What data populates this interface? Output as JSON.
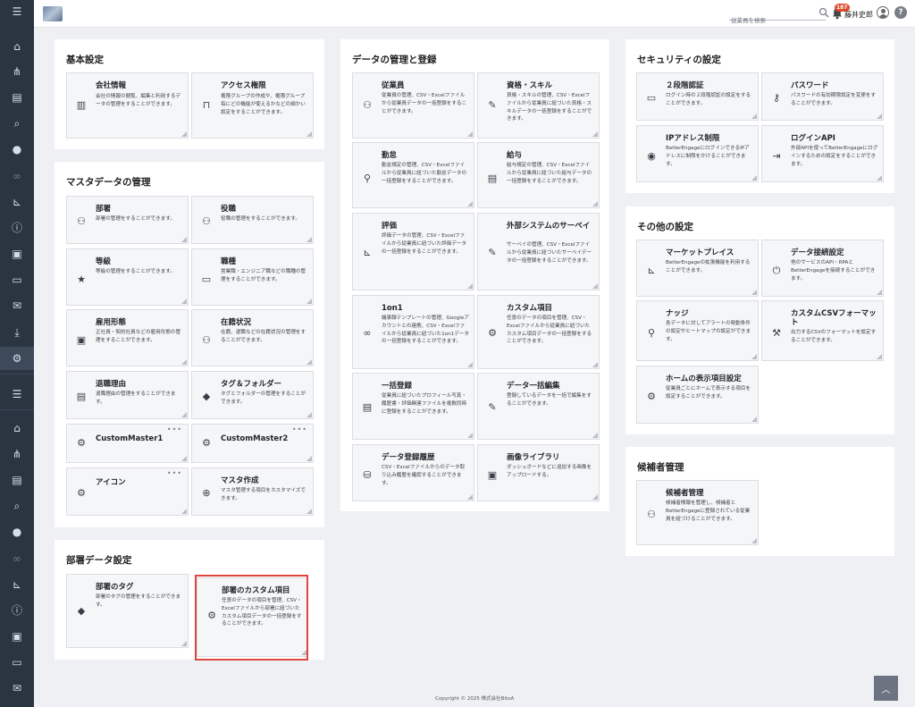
{
  "header": {
    "search_placeholder": "従業員を検索",
    "notification_count": "187",
    "user_name": "藤井史郎",
    "help_label": "?"
  },
  "sidebar": {
    "icons": [
      "menu-icon",
      "home-icon",
      "org-chart-icon",
      "document-icon",
      "search-icon",
      "chat-icon",
      "link-icon",
      "chart-icon",
      "info-icon",
      "badge-icon",
      "book-icon",
      "mail-icon",
      "download-icon",
      "user-settings-icon",
      "menu-icon",
      "home-icon",
      "org-chart-icon",
      "document-icon",
      "search-icon",
      "chat-icon",
      "link-icon",
      "chart-icon",
      "info-icon",
      "badge-icon",
      "book-icon",
      "mail-icon"
    ]
  },
  "sections": {
    "basic": {
      "title": "基本設定",
      "cards": [
        {
          "title": "会社情報",
          "desc": "会社の情報の閲覧、編集と利用するデータの管理をすることができます。",
          "icon": "building-icon"
        },
        {
          "title": "アクセス権限",
          "desc": "権限グループの作成や、権限グループ毎にどの機能が使えるかなどの細かい設定をすることができます。",
          "icon": "lock-icon"
        }
      ]
    },
    "master": {
      "title": "マスタデータの管理",
      "cards": [
        {
          "title": "部署",
          "desc": "部署の管理をすることができます。",
          "icon": "department-icon"
        },
        {
          "title": "役職",
          "desc": "役職の管理をすることができます。",
          "icon": "position-icon"
        },
        {
          "title": "等級",
          "desc": "等級の管理をすることができます。",
          "icon": "star-icon"
        },
        {
          "title": "職種",
          "desc": "営業職・エンジニア職などの職種の管理をすることができます。",
          "icon": "briefcase-icon"
        },
        {
          "title": "雇用形態",
          "desc": "正社員・契約社員などの雇用形態の管理をすることができます。",
          "icon": "id-card-icon"
        },
        {
          "title": "在籍状況",
          "desc": "在籍、退職などの在籍状況の管理をすることができます。",
          "icon": "status-icon"
        },
        {
          "title": "退職理由",
          "desc": "退職理由の管理をすることができます。",
          "icon": "exit-icon"
        },
        {
          "title": "タグ＆フォルダー",
          "desc": "タグとフォルダーの管理をすることができます。",
          "icon": "tag-icon"
        },
        {
          "title": "CustomMaster1",
          "desc": "",
          "icon": "gears-icon",
          "dots": "•••"
        },
        {
          "title": "CustomMaster2",
          "desc": "",
          "icon": "gears-icon",
          "dots": "•••"
        },
        {
          "title": "アイコン",
          "desc": "",
          "icon": "gears-icon",
          "dots": "•••"
        },
        {
          "title": "マスタ作成",
          "desc": "マスタ管理する項目をカスタマイズできます。",
          "icon": "plus-circle-icon"
        }
      ]
    },
    "dept": {
      "title": "部署データ設定",
      "cards": [
        {
          "title": "部署のタグ",
          "desc": "部署のタグの管理をすることができます。",
          "icon": "tag-icon"
        },
        {
          "title": "部署のカスタム項目",
          "desc": "任意のデータの項目を管理、CSV・Excelファイルから部署に紐づいたカスタム項目データの一括登録をすることができます。",
          "icon": "gear-icon"
        }
      ]
    },
    "data": {
      "title": "データの管理と登録",
      "cards": [
        {
          "title": "従業員",
          "desc": "従業員の管理、CSV・Excelファイルから従業員データの一括登録をすることができます。",
          "icon": "users-icon"
        },
        {
          "title": "資格・スキル",
          "desc": "資格・スキルの管理、CSV・Excelファイルから従業員に紐づいた資格・スキルデータの一括登録をすることができます。",
          "icon": "skill-icon"
        },
        {
          "title": "勤怠",
          "desc": "勤怠規定の管理、CSV・Excelファイルから従業員に紐づいた勤怠データの一括登録をすることができます。",
          "icon": "attendance-icon"
        },
        {
          "title": "給与",
          "desc": "給与規定の管理、CSV・Excelファイルから従業員に紐づいた給与データの一括登録をすることができます。",
          "icon": "salary-icon"
        },
        {
          "title": "評価",
          "desc": "評価データの管理、CSV・Excelファイルから従業員に紐づいた評価データの一括登録をすることができます。",
          "icon": "evaluation-icon"
        },
        {
          "title": "外部システムのサーベイ",
          "desc": "サーベイの管理、CSV・Excelファイルから従業員に紐づいたサーベイデータの一括登録をすることができます。",
          "icon": "survey-icon"
        },
        {
          "title": "1on1",
          "desc": "議事録テンプレートの管理、Googleアカウントとの連携、CSV・Excelファイルから従業員に紐づいた1on1データの一括登録をすることができます。",
          "icon": "meeting-icon"
        },
        {
          "title": "カスタム項目",
          "desc": "任意のデータの項目を管理、CSV・Excelファイルから従業員に紐づいたカスタム項目データの一括登録をすることができます。",
          "icon": "gear-icon"
        },
        {
          "title": "一括登録",
          "desc": "従業員に紐づいたプロフィール写真・履歴書・評価関連ファイルを複数同時に登録をすることができます。",
          "icon": "bulk-upload-icon"
        },
        {
          "title": "データ一括編集",
          "desc": "登録しているデータを一括で編集をすることができます。",
          "icon": "pencil-icon"
        },
        {
          "title": "データ登録履歴",
          "desc": "CSV・Excelファイルからのデータ取り込み履歴を確認することができます。",
          "icon": "database-icon"
        },
        {
          "title": "画像ライブラリ",
          "desc": "ダッシュボードなどに追加する画像をアップロードする。",
          "icon": "image-icon"
        }
      ]
    },
    "security": {
      "title": "セキュリティの設定",
      "cards": [
        {
          "title": "２段階認証",
          "desc": "ログイン時の２段階認証の設定をすることができます。",
          "icon": "two-factor-icon"
        },
        {
          "title": "パスワード",
          "desc": "パスワードの有効期限設定を変更をすることができます。",
          "icon": "key-icon"
        },
        {
          "title": "IPアドレス制限",
          "desc": "BetterEngageにログインできるIPアドレスに制限をかけることができます。",
          "icon": "location-icon"
        },
        {
          "title": "ログインAPI",
          "desc": "外部APIを使ってBetterEngageにログインするための設定をすることができます。",
          "icon": "login-icon"
        }
      ]
    },
    "other": {
      "title": "その他の設定",
      "cards": [
        {
          "title": "マーケットプレイス",
          "desc": "BetterEngageの拡張機能を利用することができます。",
          "icon": "chart-line-icon"
        },
        {
          "title": "データ接続設定",
          "desc": "他のサービスのAPI・RPAとBetterEngageを接続することができます。",
          "icon": "plug-icon"
        },
        {
          "title": "ナッジ",
          "desc": "各データに対してアラートの発動条件の設定やヒートマップの設定ができます。",
          "icon": "nudge-icon"
        },
        {
          "title": "カスタムCSVフォーマット",
          "desc": "出力するCSVのフォーマットを設定することができます。",
          "icon": "csv-format-icon"
        },
        {
          "title": "ホームの表示項目設定",
          "desc": "従業員ごとにホームで表示する項目を設定することができます。",
          "icon": "home-settings-icon"
        }
      ]
    },
    "candidate": {
      "title": "候補者管理",
      "cards": [
        {
          "title": "候補者管理",
          "desc": "候補者情報を管理し、候補者とBetterEngageに登録されている従業員を紐づけることができます。",
          "icon": "candidate-icon"
        }
      ]
    }
  },
  "footer": {
    "copyright": "Copyright © 2025 株式会社BitoA"
  }
}
